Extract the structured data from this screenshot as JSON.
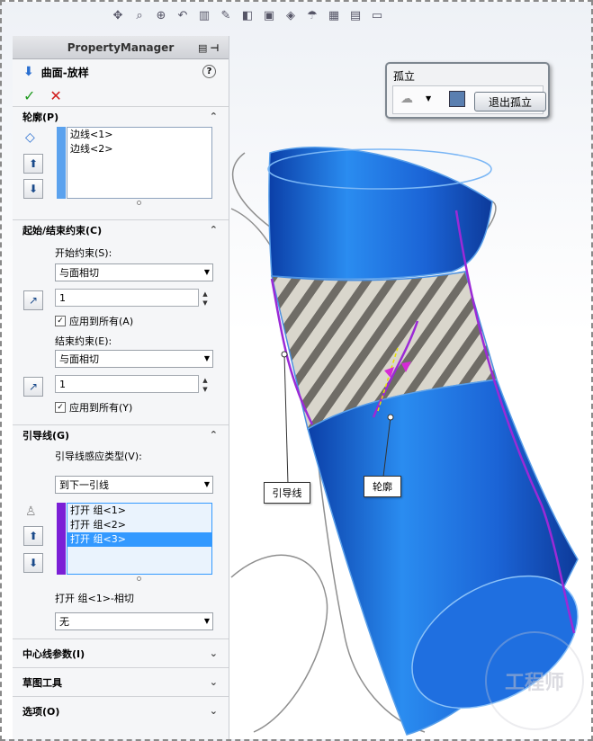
{
  "toolbar": {
    "icons": [
      "view-orient-icon",
      "zoom-fit-icon",
      "zoom-area-icon",
      "previous-view-icon",
      "section-view-icon",
      "dynamic-annotation-icon",
      "display-style-icon",
      "hide-show-icon",
      "appearance-icon",
      "scene-icon",
      "view-settings-icon",
      "render-icon",
      "monitor-icon"
    ]
  },
  "property_manager": {
    "title": "PropertyManager",
    "feature_name": "曲面-放样",
    "help": "?",
    "ok_glyph": "✓",
    "cancel_glyph": "✕",
    "profiles": {
      "header": "轮廓(P)",
      "items": [
        "边线<1>",
        "边线<2>"
      ],
      "bar_color": "#5ba2ee"
    },
    "constraints": {
      "header": "起始/结束约束(C)",
      "start_label": "开始约束(S):",
      "start_value": "与面相切",
      "start_amount": "1",
      "start_apply_all": "应用到所有(A)",
      "end_label": "结束约束(E):",
      "end_value": "与面相切",
      "end_amount": "1",
      "end_apply_all": "应用到所有(Y)"
    },
    "guides": {
      "header": "引导线(G)",
      "influence_label": "引导线感应类型(V):",
      "influence_value": "到下一引线",
      "items": [
        "打开 组<1>",
        "打开 组<2>",
        "打开 组<3>"
      ],
      "selected_index": 2,
      "bar_color": "#7b1fd6",
      "tangent_label": "打开 组<1>-相切",
      "tangent_value": "无"
    },
    "collapsed_sections": [
      "中心线参数(I)",
      "草图工具",
      "选项(O)"
    ]
  },
  "isolate": {
    "title": "孤立",
    "exit_label": "退出孤立"
  },
  "callouts": {
    "guide": "引导线",
    "profile": "轮廓"
  },
  "watermark": "工程师",
  "colors": {
    "surface": "#1f6fe0",
    "guide_curve": "#9b2ad6"
  }
}
